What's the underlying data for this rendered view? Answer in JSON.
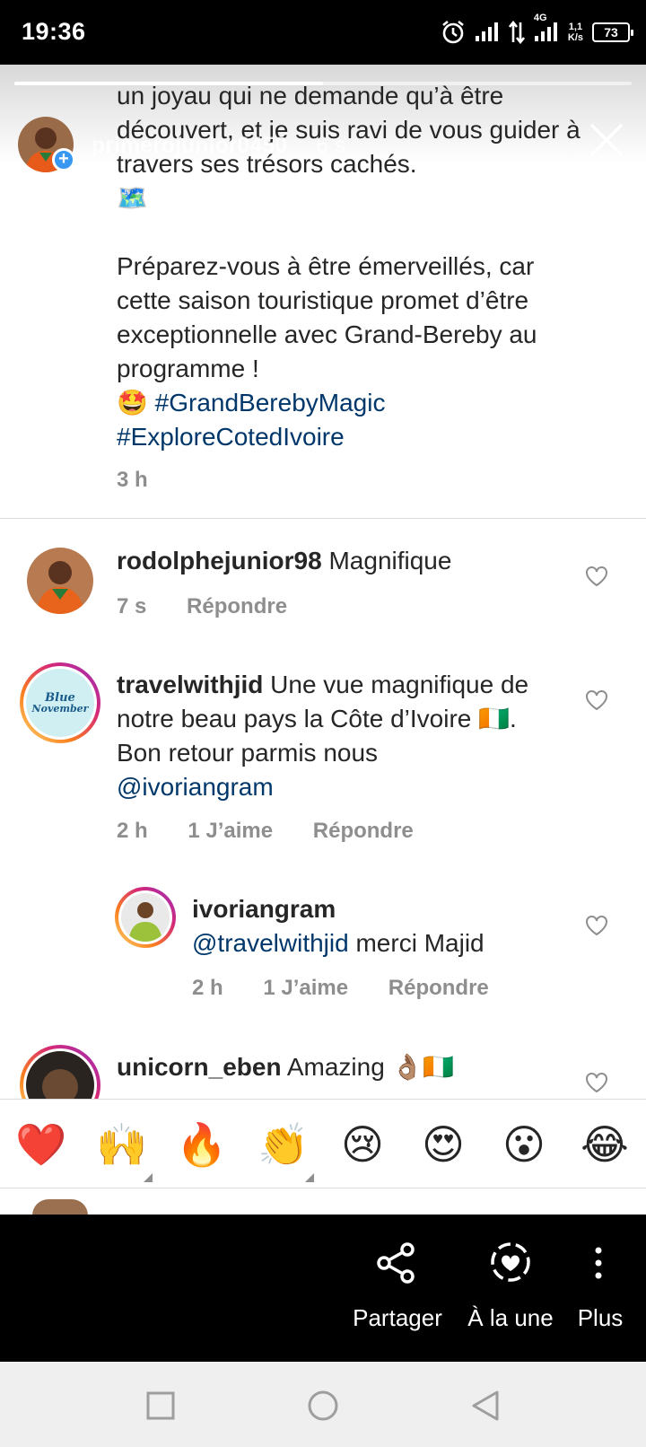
{
  "status_bar": {
    "time": "19:36",
    "network": "4G",
    "speed_value": "1,1",
    "speed_unit": "K/s",
    "battery": "73"
  },
  "story": {
    "username": "primerojunior0450",
    "time": "6 s",
    "progress": 0.5
  },
  "caption": {
    "line1": "un joyau qui ne demande qu’à être découvert, et je suis ravi de vous guider à travers ses trésors cachés.",
    "map_emoji": "🗺️",
    "line2": "Préparez-vous à être émerveillés, car cette saison touristique promet d’être exceptionnelle avec Grand-Bereby au programme !",
    "star_emoji": "🤩",
    "tag1": "#GrandBerebyMagic",
    "tag2": "#ExploreCotedIvoire",
    "time": "3 h"
  },
  "comments": [
    {
      "username": "rodolphejunior98",
      "text": "Magnifique",
      "time": "7 s",
      "reply": "Répondre"
    },
    {
      "username": "travelwithjid",
      "text": "Une vue magnifique de notre beau pays la Côte d’Ivoire",
      "flag": "🇨🇮",
      "text2": ". Bon retour parmis nous",
      "mention": "@ivoriangram",
      "time": "2 h",
      "likes": "1 J’aime",
      "reply": "Répondre",
      "avatar_text1": "Blue",
      "avatar_text2": "November"
    },
    {
      "username": "ivoriangram",
      "mention": "@travelwithjid",
      "text": "merci Majid",
      "time": "2 h",
      "likes": "1 J’aime",
      "reply": "Répondre"
    },
    {
      "username": "unicorn_eben",
      "text": "Amazing",
      "emojis": "👌🏽🇨🇮"
    }
  ],
  "reactions": [
    "❤️",
    "🙌",
    "🔥",
    "👏",
    "😢",
    "😍",
    "😮",
    "😂"
  ],
  "actions": {
    "share": "Partager",
    "highlight": "À la une",
    "more": "Plus"
  },
  "colors": {
    "link": "#00376b",
    "muted": "#8e8e8e",
    "badge": "#3897f0"
  }
}
